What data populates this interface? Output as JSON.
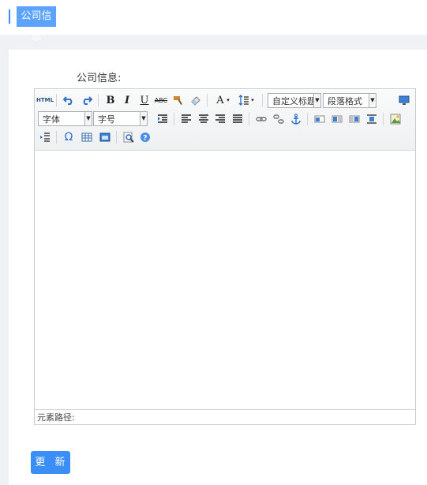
{
  "header": {
    "title": "公司信息"
  },
  "form": {
    "field_label": "公司信息:"
  },
  "editor": {
    "toolbar": {
      "html_label": "HTML",
      "bold": "B",
      "italic": "I",
      "underline": "U",
      "strike": "ABC",
      "font_color": "A",
      "custom_title": "自定义标题",
      "paragraph_format": "段落格式",
      "font_family": "字体",
      "font_size": "字号",
      "special_char": "Ω",
      "help": "?"
    },
    "status_path_label": "元素路径:"
  },
  "actions": {
    "update_label": "更 新"
  }
}
